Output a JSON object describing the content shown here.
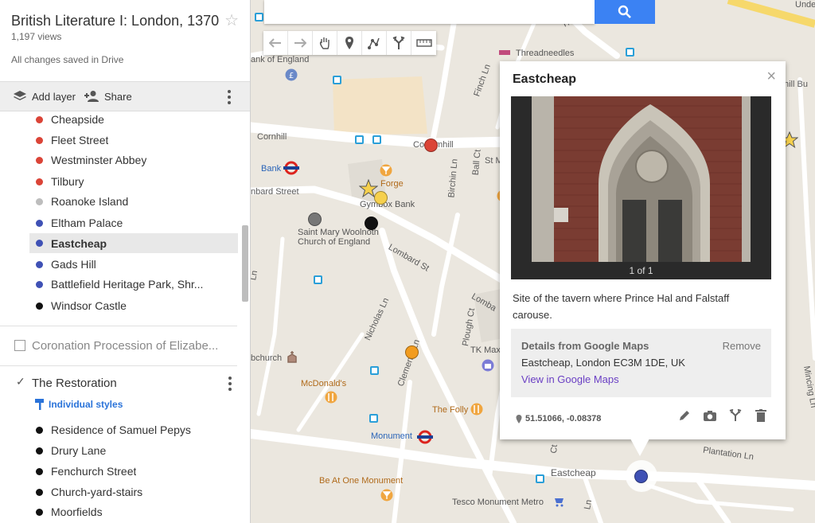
{
  "sidebar": {
    "title": "British Literature I: London, 1370-...",
    "views": "1,197 views",
    "saved": "All changes saved in Drive",
    "add_layer": "Add layer",
    "share": "Share",
    "layer1_items": [
      {
        "label": "Cheapside",
        "color": "#db4437"
      },
      {
        "label": "Fleet Street",
        "color": "#db4437"
      },
      {
        "label": "Westminster Abbey",
        "color": "#db4437"
      },
      {
        "label": "Tilbury",
        "color": "#db4437"
      },
      {
        "label": "Roanoke Island",
        "color": "#bdbdbd"
      },
      {
        "label": "Eltham Palace",
        "color": "#3f51b5"
      },
      {
        "label": "Eastcheap",
        "color": "#3f51b5"
      },
      {
        "label": "Gads Hill",
        "color": "#3f51b5"
      },
      {
        "label": "Battlefield Heritage Park, Shr...",
        "color": "#3f51b5"
      },
      {
        "label": "Windsor Castle",
        "color": "#111111"
      }
    ],
    "layer2": {
      "name": "Coronation Procession of Elizabe..."
    },
    "layer3": {
      "name": "The Restoration",
      "styles": "Individual styles",
      "items": [
        {
          "label": "Residence of Samuel Pepys"
        },
        {
          "label": "Drury Lane"
        },
        {
          "label": "Fenchurch Street"
        },
        {
          "label": "Church-yard-stairs"
        },
        {
          "label": "Moorfields"
        }
      ]
    }
  },
  "map": {
    "roads": [
      {
        "text": "Cornhill"
      },
      {
        "text": "Co"
      },
      {
        "text": "mhill"
      },
      {
        "text": "Lombard St"
      },
      {
        "text": "Nicholas Ln"
      },
      {
        "text": "Clements Ln"
      },
      {
        "text": "Birchin Ln"
      },
      {
        "text": "Ball Ct"
      },
      {
        "text": "St M"
      },
      {
        "text": "Plough Ct"
      },
      {
        "text": "Finch Ln"
      },
      {
        "text": "Eastcheap"
      },
      {
        "text": "Plantation Ln"
      },
      {
        "text": "Lomba"
      },
      {
        "text": "nbard Street"
      },
      {
        "text": "bchurch"
      },
      {
        "text": "ank of England"
      },
      {
        "text": "Threadneedles"
      },
      {
        "text": "Threa"
      },
      {
        "text": "Unde"
      },
      {
        "text": "hill Bu"
      },
      {
        "text": "Mincing Ln"
      },
      {
        "text": "Ct"
      },
      {
        "text": "Ln"
      },
      {
        "text": "Ln"
      }
    ],
    "pois": [
      {
        "text": "Bank"
      },
      {
        "text": "Forge"
      },
      {
        "text": "Gymbox Bank"
      },
      {
        "text": "Saint Mary Woolnoth"
      },
      {
        "text": "Church of England"
      },
      {
        "text": "McDonald's"
      },
      {
        "text": "The Folly"
      },
      {
        "text": "Monument"
      },
      {
        "text": "Be At One Monument"
      },
      {
        "text": "Tesco Monument Metro"
      },
      {
        "text": "TK Max"
      }
    ]
  },
  "info": {
    "title": "Eastcheap",
    "photo_count": "1 of 1",
    "description": "Site of the tavern where Prince Hal and Falstaff carouse.",
    "details_header": "Details from Google Maps",
    "remove": "Remove",
    "address": "Eastcheap, London EC3M 1DE, UK",
    "link": "View in Google Maps",
    "coords": "51.51066, -0.08378"
  }
}
